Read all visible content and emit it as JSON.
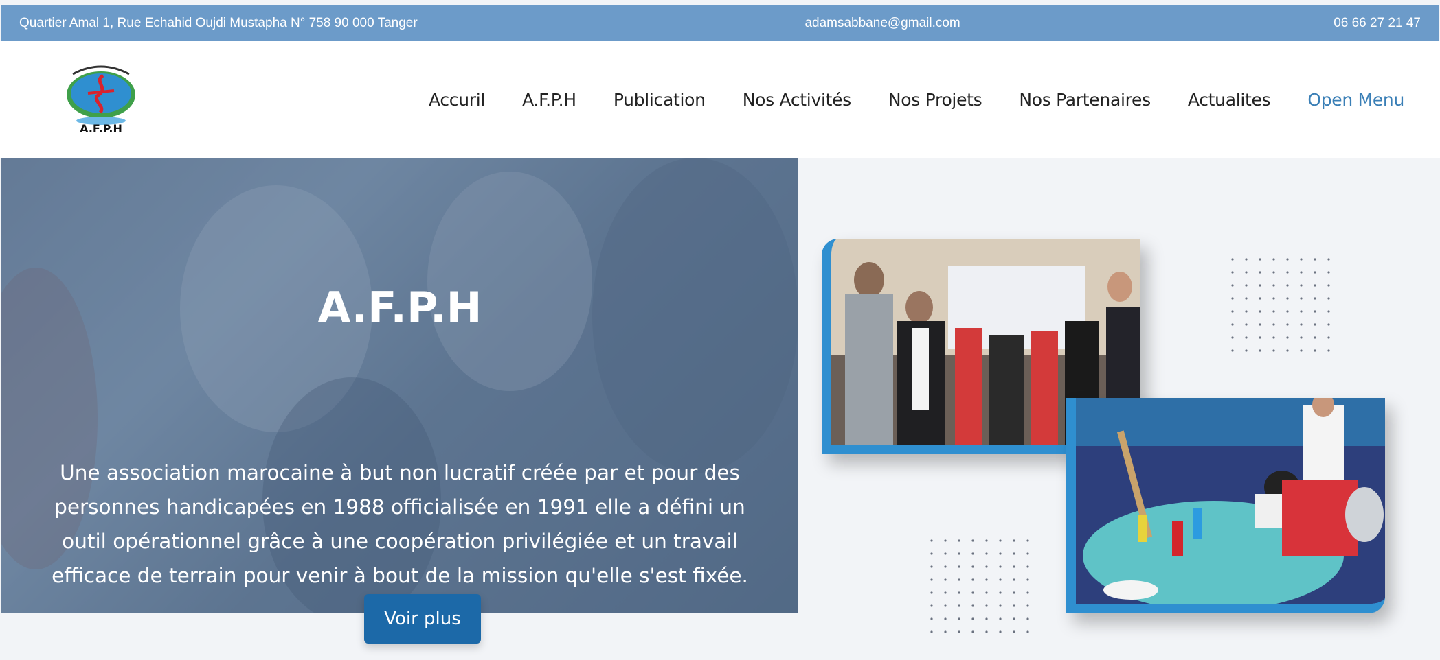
{
  "topbar": {
    "address": "Quartier Amal 1, Rue Echahid Oujdi Mustapha N° 758 90 000 Tanger",
    "email": "adamsabbane@gmail.com",
    "phone": "06 66 27 21 47"
  },
  "header": {
    "logo_text": "A.F.P.H",
    "nav": [
      "Accuril",
      "A.F.P.H",
      "Publication",
      "Nos Activités",
      "Nos Projets",
      "Nos Partenaires",
      "Actualites",
      "Open Menu"
    ]
  },
  "hero": {
    "title": "A.F.P.H",
    "description": "Une association marocaine à but non lucratif créée par et pour des personnes handicapées en 1988 officialisée en 1991 elle a défini un outil opérationnel grâce à une coopération privilégiée et un travail efficace de terrain pour venir à bout de la mission qu'elle s'est fixée.",
    "button_label": "Voir plus"
  },
  "colors": {
    "topbar": "#6c9bc9",
    "accent": "#2f8fd0",
    "button": "#1c69a8",
    "nav_active": "#3a7fb6"
  }
}
